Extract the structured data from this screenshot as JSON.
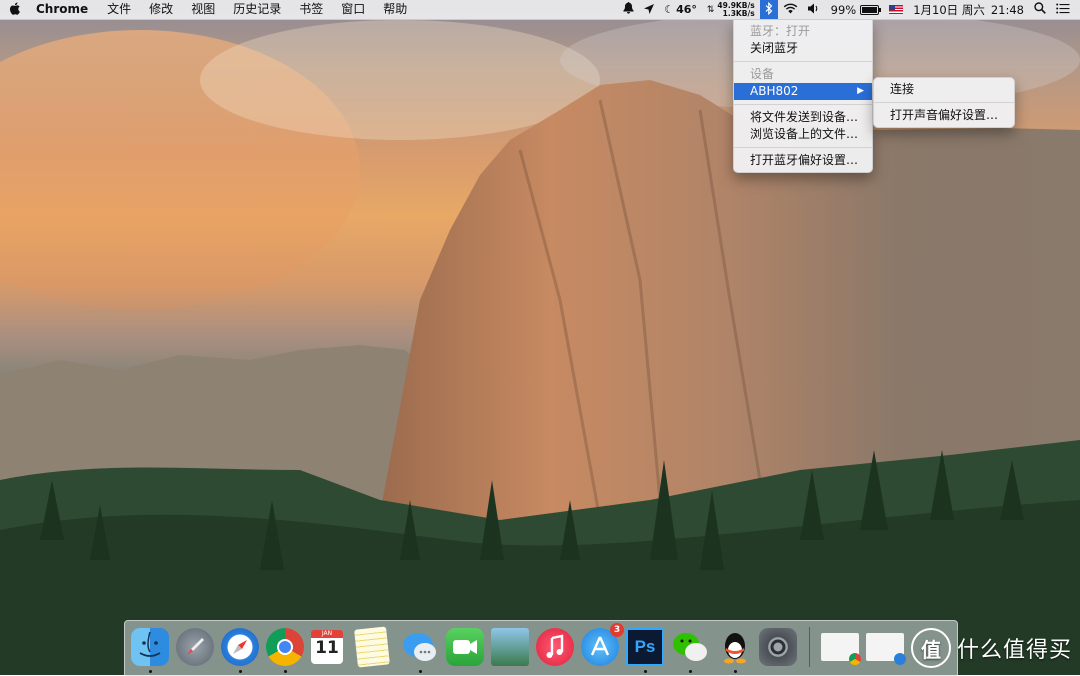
{
  "menubar": {
    "app_name": "Chrome",
    "menus": [
      "文件",
      "修改",
      "视图",
      "历史记录",
      "书签",
      "窗口",
      "帮助"
    ],
    "temperature": "46°",
    "net_up": "49.9KB/s",
    "net_down": "1.3KB/s",
    "battery_text": "99%",
    "battery_level": 0.99,
    "date": "1月10日 周六",
    "time": "21:48",
    "icons": [
      "apple-icon",
      "notification-icon",
      "location-icon",
      "network-arrows-icon",
      "bluetooth-icon",
      "wifi-icon",
      "volume-icon",
      "battery-icon",
      "flag-icon",
      "search-icon",
      "list-icon"
    ]
  },
  "bluetooth_menu": {
    "status": "蓝牙：打开",
    "toggle": "关闭蓝牙",
    "devices_header": "设备",
    "device": "ABH802",
    "send_file": "将文件发送到设备…",
    "browse": "浏览设备上的文件…",
    "prefs": "打开蓝牙偏好设置…"
  },
  "device_submenu": {
    "connect": "连接",
    "sound_prefs": "打开声音偏好设置…"
  },
  "dock": {
    "apps": [
      "Finder",
      "Launchpad",
      "Safari",
      "Chrome",
      "Calendar",
      "Notes",
      "Messages",
      "FaceTime",
      "iPhoto",
      "iTunes",
      "App Store",
      "Photoshop",
      "WeChat",
      "QQ",
      "System Preferences"
    ],
    "calendar_day": "11",
    "calendar_month": "JAN",
    "appstore_badge": "3",
    "photoshop_label": "Ps"
  },
  "watermark": {
    "glyph": "值",
    "text": "什么值得买"
  },
  "colors": {
    "highlight": "#2a6fd8",
    "menubar": "#ececee"
  }
}
